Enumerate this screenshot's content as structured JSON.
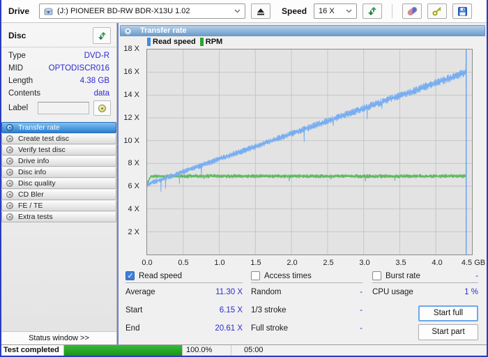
{
  "toolbar": {
    "drive_label": "Drive",
    "drive_value": "(J:)  PIONEER BD-RW   BDR-X13U 1.02",
    "speed_label": "Speed",
    "speed_value": "16 X"
  },
  "disc_panel": {
    "title": "Disc",
    "fields": [
      {
        "label": "Type",
        "value": "DVD-R"
      },
      {
        "label": "MID",
        "value": "OPTODISCR016"
      },
      {
        "label": "Length",
        "value": "4.38 GB"
      },
      {
        "label": "Contents",
        "value": "data"
      }
    ],
    "label_field": {
      "label": "Label",
      "value": ""
    }
  },
  "nav": {
    "items": [
      {
        "label": "Transfer rate",
        "selected": true
      },
      {
        "label": "Create test disc",
        "selected": false
      },
      {
        "label": "Verify test disc",
        "selected": false
      },
      {
        "label": "Drive info",
        "selected": false
      },
      {
        "label": "Disc info",
        "selected": false
      },
      {
        "label": "Disc quality",
        "selected": false
      },
      {
        "label": "CD Bler",
        "selected": false
      },
      {
        "label": "FE / TE",
        "selected": false
      },
      {
        "label": "Extra tests",
        "selected": false
      }
    ]
  },
  "status_window_button": "Status window >>",
  "chart_panel": {
    "title": "Transfer rate"
  },
  "chart_data": {
    "type": "line",
    "title": "Transfer rate",
    "legend": [
      "Read speed",
      "RPM"
    ],
    "legend_colors": [
      "#3d8de6",
      "#2fa32f"
    ],
    "x_unit": "GB",
    "x_max": 4.5,
    "y_max": 18,
    "end_x": 4.42,
    "x_ticks": [
      {
        "v": 0.0,
        "label": "0.0"
      },
      {
        "v": 0.5,
        "label": "0.5"
      },
      {
        "v": 1.0,
        "label": "1.0"
      },
      {
        "v": 1.5,
        "label": "1.5"
      },
      {
        "v": 2.0,
        "label": "2.0"
      },
      {
        "v": 2.5,
        "label": "2.5"
      },
      {
        "v": 3.0,
        "label": "3.0"
      },
      {
        "v": 3.5,
        "label": "3.5"
      },
      {
        "v": 4.0,
        "label": "4.0"
      },
      {
        "v": 4.5,
        "label": "4.5 GB"
      }
    ],
    "y_ticks": [
      {
        "v": 18,
        "label": "18 X"
      },
      {
        "v": 16,
        "label": "16 X"
      },
      {
        "v": 14,
        "label": "14 X"
      },
      {
        "v": 12,
        "label": "12 X"
      },
      {
        "v": 10,
        "label": "10 X"
      },
      {
        "v": 8,
        "label": "8 X"
      },
      {
        "v": 6,
        "label": "6 X"
      },
      {
        "v": 4,
        "label": "4 X"
      },
      {
        "v": 2,
        "label": "2 X"
      }
    ],
    "series": [
      {
        "name": "Read speed",
        "shape": "linear",
        "color": "#79aef0",
        "y_start": 6.15,
        "y_end": 16.0,
        "end_spike": 17.6,
        "noise": 0.3
      },
      {
        "name": "RPM",
        "shape": "constant",
        "color": "#62b962",
        "y_start": 6.2,
        "y_value": 6.88,
        "end_spike": 8.1,
        "noise": 0.14
      }
    ],
    "cursor_line": {
      "x": 4.42,
      "color": "#5e9bee"
    },
    "grid_color": "#c6c6c6",
    "plot_bg": "#e3e3e3"
  },
  "stats": {
    "columns": [
      {
        "title": "Read speed",
        "checked": true,
        "header_value": "",
        "rows": [
          {
            "label": "Average",
            "value": "11.30 X"
          },
          {
            "label": "Start",
            "value": "6.15 X"
          },
          {
            "label": "End",
            "value": "20.61 X"
          }
        ]
      },
      {
        "title": "Access times",
        "checked": false,
        "header_value": "",
        "rows": [
          {
            "label": "Random",
            "value": "-"
          },
          {
            "label": "1/3 stroke",
            "value": "-"
          },
          {
            "label": "Full stroke",
            "value": "-"
          }
        ]
      },
      {
        "title": "Burst rate",
        "checked": false,
        "header_value": "-",
        "rows": [
          {
            "label": "CPU usage",
            "value": "1 %"
          }
        ]
      }
    ]
  },
  "buttons": {
    "start_full": "Start full",
    "start_part": "Start part"
  },
  "statusbar": {
    "text": "Test completed",
    "percent": "100.0%",
    "progress_value": 100,
    "time": "05:00"
  }
}
